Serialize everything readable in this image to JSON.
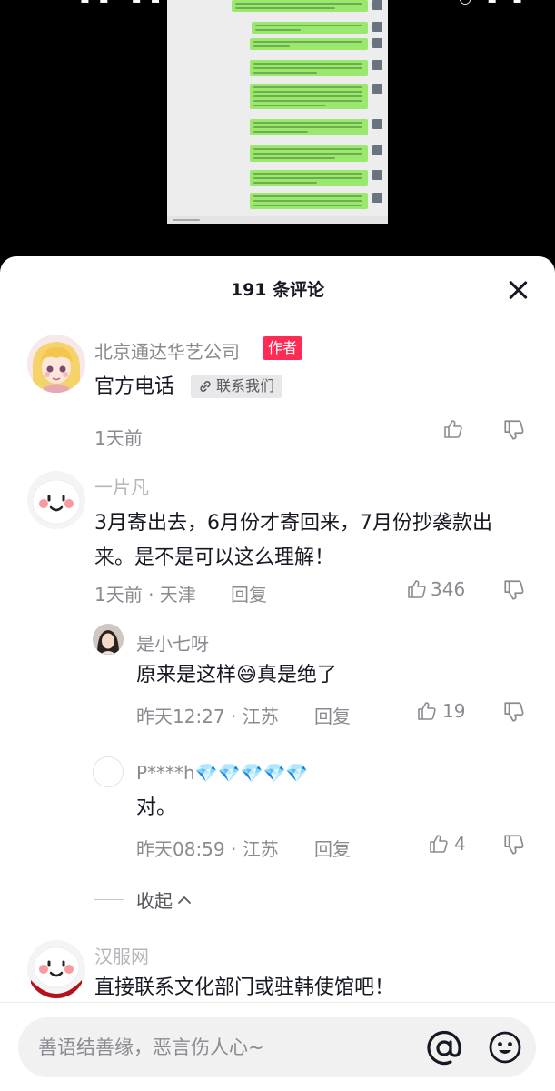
{
  "comments_header": {
    "title": "191 条评论"
  },
  "comments": [
    {
      "user": "北京通达华艺公司",
      "badge": "作者",
      "text": "官方电话",
      "link_label": "联系我们",
      "time": "1天前"
    },
    {
      "user": "一片凡",
      "text": "3月寄出去，6月份才寄回来，7月份抄袭款出来。是不是可以这么理解！",
      "time": "1天前 · 天津",
      "reply_label": "回复",
      "likes": "346",
      "replies": [
        {
          "user": "是小七呀",
          "text": "原来是这样😅真是绝了",
          "time": "昨天12:27 · 江苏",
          "reply_label": "回复",
          "likes": "19"
        },
        {
          "user": "P****h💎💎💎💎💎",
          "text": "对。",
          "time": "昨天08:59 · 江苏",
          "reply_label": "回复",
          "likes": "4"
        }
      ],
      "collapse_label": "收起"
    },
    {
      "user": "汉服网",
      "text": "直接联系文化部门或驻韩使馆吧！"
    }
  ],
  "input": {
    "placeholder": "善语结善缘，恶言伤人心~"
  },
  "colors": {
    "author_badge": "#fe2c55",
    "bubble_green": "#9be86e",
    "muted_text": "#8a8b91"
  },
  "icons": [
    "close-icon",
    "link-icon",
    "like-icon",
    "dislike-icon",
    "chevron-up-icon",
    "at-icon",
    "emoji-icon"
  ]
}
